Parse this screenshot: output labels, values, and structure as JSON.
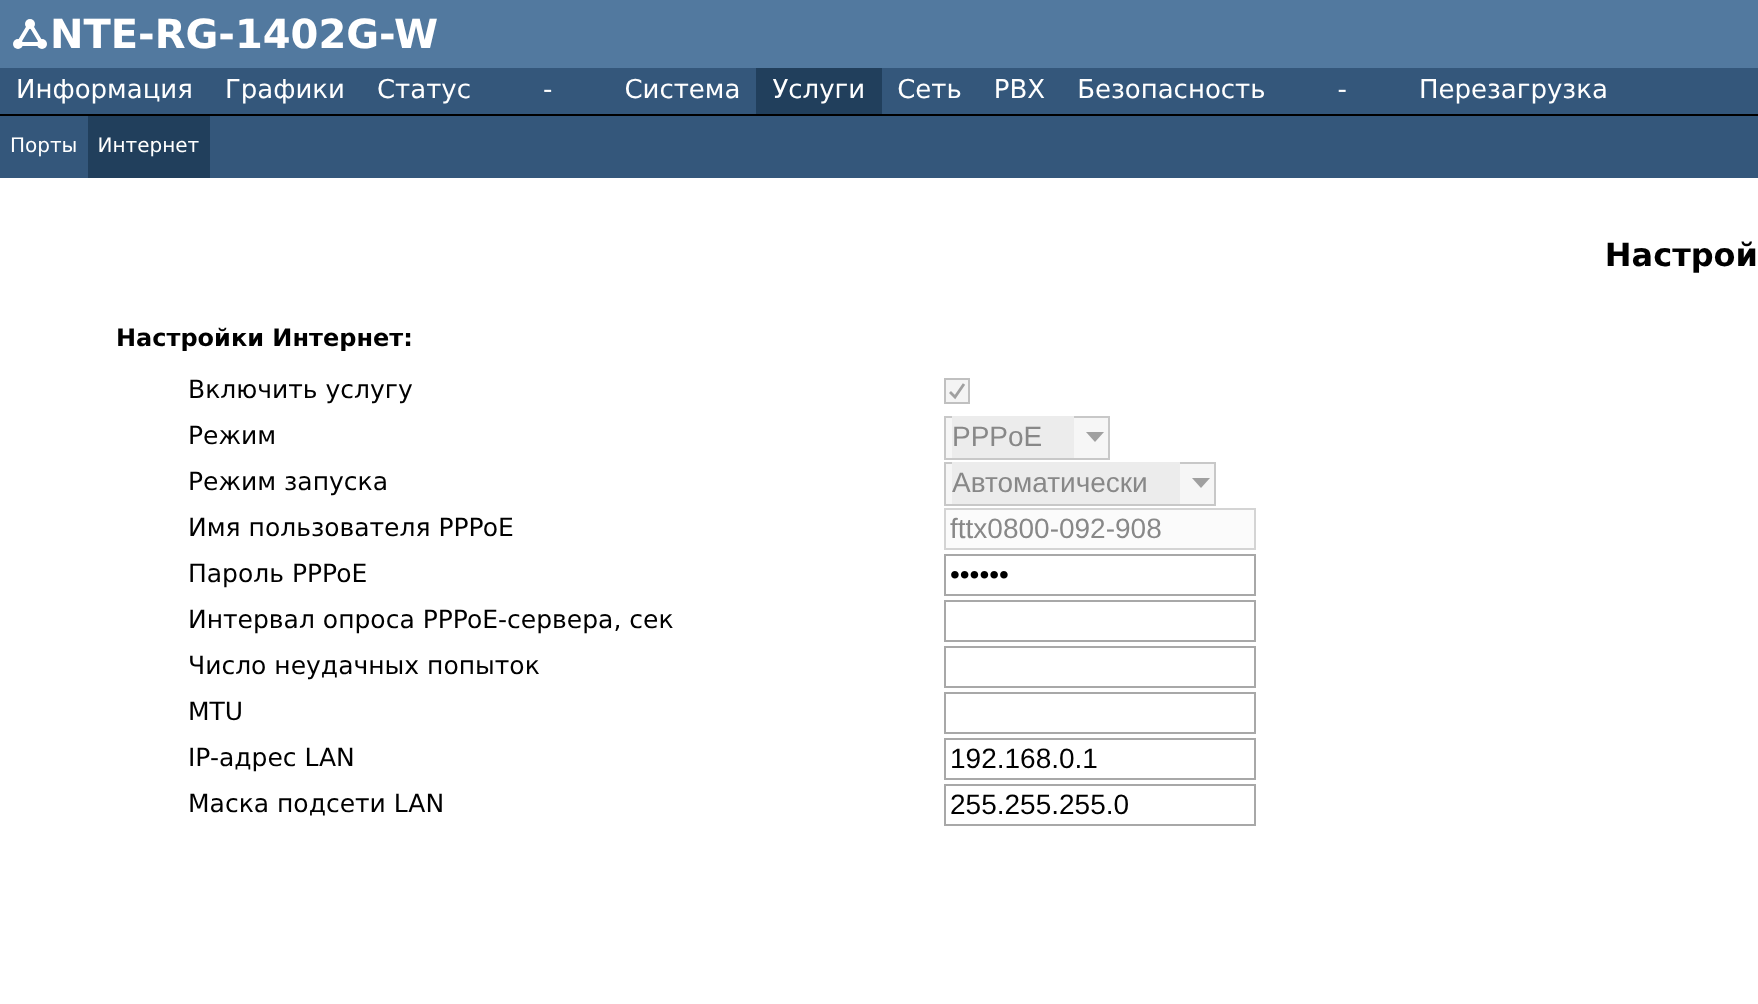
{
  "header": {
    "title": "NTE-RG-1402G-W"
  },
  "nav": [
    {
      "label": "Информация",
      "selected": false,
      "kind": "item"
    },
    {
      "label": "Графики",
      "selected": false,
      "kind": "item"
    },
    {
      "label": "Статус",
      "selected": false,
      "kind": "item"
    },
    {
      "label": "-",
      "selected": false,
      "kind": "separator"
    },
    {
      "label": "Система",
      "selected": false,
      "kind": "item"
    },
    {
      "label": "Услуги",
      "selected": true,
      "kind": "item"
    },
    {
      "label": "Сеть",
      "selected": false,
      "kind": "item"
    },
    {
      "label": "PBX",
      "selected": false,
      "kind": "item"
    },
    {
      "label": "Безопасность",
      "selected": false,
      "kind": "item"
    },
    {
      "label": "-",
      "selected": false,
      "kind": "separator"
    },
    {
      "label": "Перезагрузка",
      "selected": false,
      "kind": "item"
    }
  ],
  "subnav": [
    {
      "label": "Порты",
      "selected": false
    },
    {
      "label": "Интернет",
      "selected": true
    }
  ],
  "page_title": "Настрой",
  "form": {
    "heading": "Настройки Интернет:",
    "rows": [
      {
        "label": "Включить услугу",
        "kind": "checkbox",
        "checked": true,
        "disabled": true
      },
      {
        "label": "Режим",
        "kind": "select",
        "value": "PPPoE",
        "disabled": true
      },
      {
        "label": "Режим запуска",
        "kind": "select",
        "value": "Автоматически",
        "disabled": true
      },
      {
        "label": "Имя пользователя PPPoE",
        "kind": "text",
        "value": "fttx0800-092-908",
        "disabled": true
      },
      {
        "label": "Пароль PPPoE",
        "kind": "text",
        "value": "••••••",
        "disabled": false
      },
      {
        "label": "Интервал опроса PPPoE-сервера, сек",
        "kind": "text",
        "disabled": false
      },
      {
        "label": "Число неудачных попыток",
        "kind": "text",
        "disabled": false
      },
      {
        "label": "MTU",
        "kind": "text",
        "disabled": false
      },
      {
        "label": "IP-адрес LAN",
        "kind": "text",
        "value": "192.168.0.1",
        "disabled": false
      },
      {
        "label": "Маска подсети LAN",
        "kind": "text",
        "value": "255.255.255.0",
        "disabled": false
      }
    ]
  }
}
